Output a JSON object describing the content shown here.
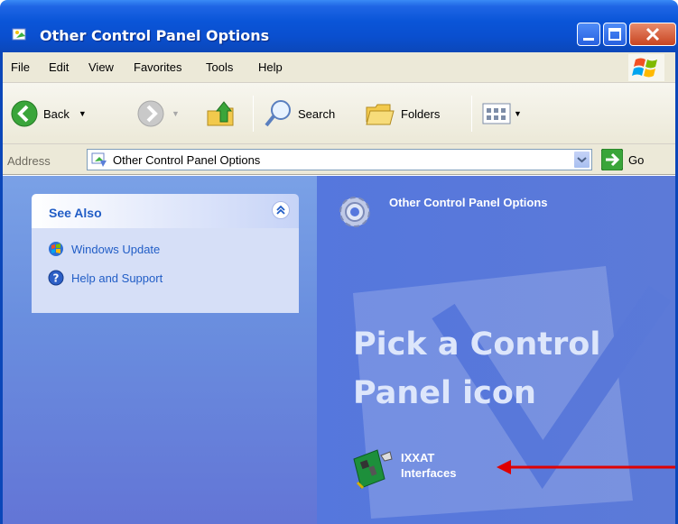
{
  "window": {
    "title": "Other Control Panel Options"
  },
  "menu": [
    "File",
    "Edit",
    "View",
    "Favorites",
    "Tools",
    "Help"
  ],
  "toolbar": {
    "back_label": "Back",
    "search_label": "Search",
    "folders_label": "Folders"
  },
  "address": {
    "label": "Address",
    "value": "Other Control Panel Options",
    "go_label": "Go"
  },
  "see_also": {
    "title": "See Also",
    "links": [
      {
        "label": "Windows Update",
        "icon": "windows-update-icon"
      },
      {
        "label": "Help and Support",
        "icon": "help-icon"
      }
    ]
  },
  "main": {
    "category_title": "Other Control Panel Options",
    "pick_line1": "Pick a Control",
    "pick_line2": "Panel icon",
    "items": [
      {
        "label_line1": "IXXAT",
        "label_line2": "Interfaces",
        "icon": "network-card-icon"
      }
    ]
  },
  "colors": {
    "titlebar": "#0a55d8",
    "link": "#215dc6",
    "annotation_arrow": "#e00000"
  }
}
